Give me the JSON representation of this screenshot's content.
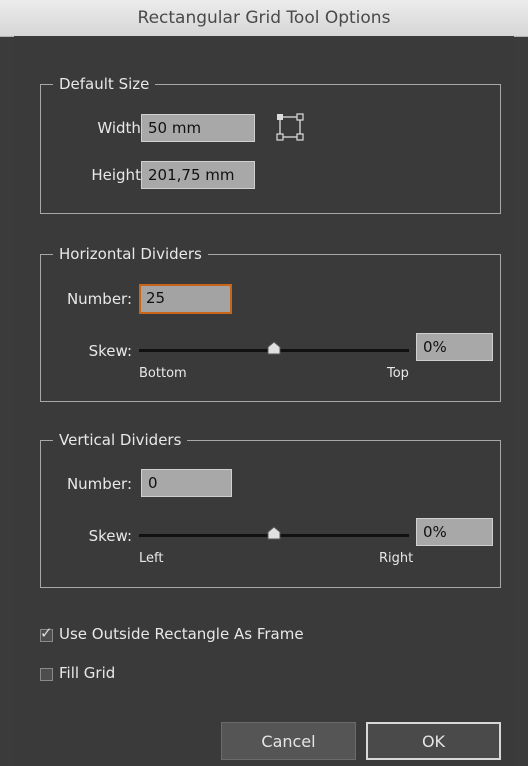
{
  "window": {
    "title": "Rectangular Grid Tool Options"
  },
  "default_size": {
    "legend": "Default Size",
    "width_label": "Width:",
    "width_value": "50 mm",
    "height_label": "Height:",
    "height_value": "201,75 mm"
  },
  "horizontal_dividers": {
    "legend": "Horizontal Dividers",
    "number_label": "Number:",
    "number_value": "25",
    "skew_label": "Skew:",
    "skew_value": "0%",
    "slider_level": 0.5,
    "left_caption": "Bottom",
    "right_caption": "Top"
  },
  "vertical_dividers": {
    "legend": "Vertical Dividers",
    "number_label": "Number:",
    "number_value": "0",
    "skew_label": "Skew:",
    "skew_value": "0%",
    "slider_level": 0.5,
    "left_caption": "Left",
    "right_caption": "Right"
  },
  "options": {
    "use_outside_label": "Use Outside Rectangle As Frame",
    "use_outside_checked": true,
    "fill_grid_label": "Fill Grid",
    "fill_grid_checked": false
  },
  "buttons": {
    "cancel": "Cancel",
    "ok": "OK"
  },
  "icons": {
    "reference_point": "reference-point-icon",
    "slider_thumb": "slider-thumb-icon",
    "check": "checkmark-icon"
  },
  "colors": {
    "focus_border": "#c8651b",
    "dialog_bg": "#3a3a3a",
    "field_bg": "#a8a8a8"
  }
}
